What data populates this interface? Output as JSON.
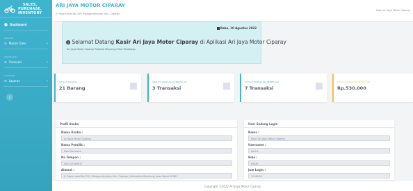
{
  "brand": {
    "line1": "SALES,",
    "line2": "PURCHASE,",
    "line3": "INVENTORY"
  },
  "sidebar": {
    "dashboard": "Dashboard",
    "heading1": "MASTER",
    "master": "Master Data",
    "heading2": "TRANSAKSI",
    "transaksi": "Transaksi",
    "heading3": "LAPORAN",
    "laporan": "Laporan",
    "chevron": "›",
    "toggle": "‹"
  },
  "topbar": {
    "title": "ARI JAYA MOTOR CIPARAY",
    "subtitle": "Jl. Raya Laswi No.749, Mangguntinjaha, Kec. Ciparay",
    "user": "Kasir Ari Jaya Motor Ciparay"
  },
  "welcome": {
    "date": "Rabu, 10 Agustus 2022",
    "greeting": "Selamat Datang",
    "name": "Kasir Ari Jaya Motor Ciparay",
    "suffix": "di Aplikasi Ari Jaya Motor Ciparay",
    "sub": "Ari Jaya Motor Ciparay Rahasia Motornya Para Pembalap"
  },
  "cards": [
    {
      "label": "JUMLAH BARANG",
      "value": "21 Barang",
      "color": "#3fb4cf"
    },
    {
      "label": "JUMLAH TRANSAKSI PENJUALAN",
      "value": "3 Transaksi",
      "color": "#3fb4cf"
    },
    {
      "label": "JUMLAH TRANSAKSI PEMBELIAN",
      "value": "7 Transaksi",
      "color": "#3fb4cf"
    },
    {
      "label": "TOTAL TRANSAKSI PENJUALAN",
      "value": "Rp.530.000",
      "color": "#f6c23e"
    }
  ],
  "profil": {
    "title": "Profil Usaha",
    "nama_label": "Nama Usaha :",
    "nama": "Ari Jaya Motor Ciparay",
    "pemilik_label": "Nama Pemilik :",
    "pemilik": "Deni Permana",
    "telepon_label": "No Telepon :",
    "telepon": "082147463547",
    "alamat_label": "Alamat :",
    "alamat": "Jl. Raya Laswi No.749, Mangguntinjaha, Kec. Ciparay, Kabupaten Bandung, Jawa Barat 40381"
  },
  "login": {
    "title": "User Sedang Login",
    "nama_label": "Nama :",
    "nama": "Kasir Ari Jaya Motor Ciparay",
    "username_label": "Username :",
    "username": "kasir1",
    "role_label": "Role :",
    "role": "KASIR",
    "jam_label": "Jam Login :",
    "jam": "13:46:56"
  },
  "footer": "Copyright ©2022 Ari Jaya Motor Ciparay"
}
